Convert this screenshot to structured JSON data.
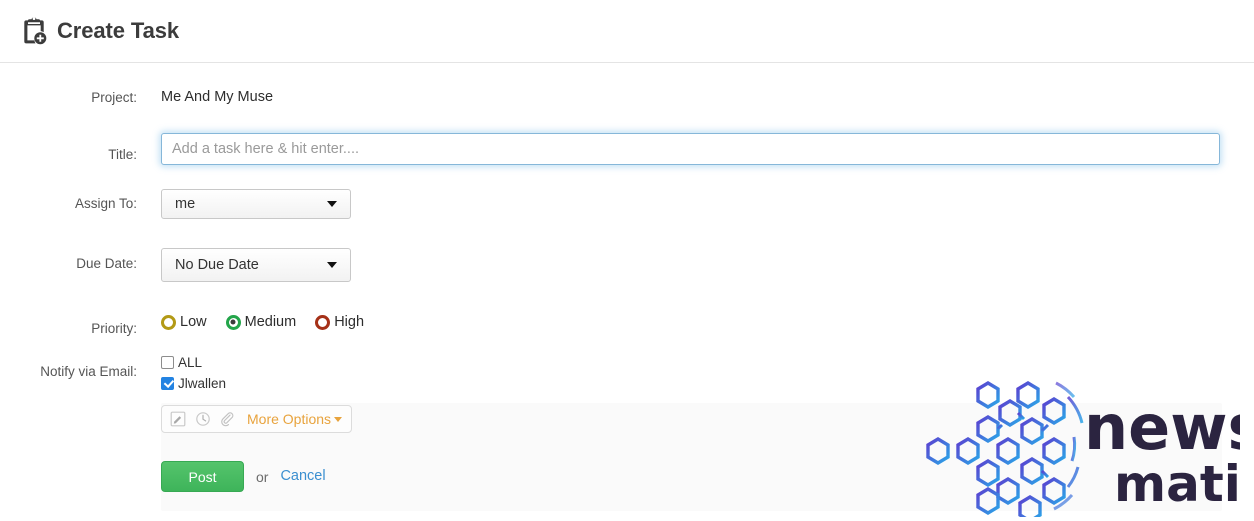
{
  "header": {
    "title": "Create Task",
    "icon": "clipboard-plus-icon"
  },
  "form": {
    "project": {
      "label": "Project:",
      "value": "Me And My Muse"
    },
    "title": {
      "label": "Title:",
      "value": "",
      "placeholder": "Add a task here & hit enter...."
    },
    "assign_to": {
      "label": "Assign To:",
      "value": "me"
    },
    "due_date": {
      "label": "Due Date:",
      "value": "No Due Date"
    },
    "priority": {
      "label": "Priority:",
      "options": [
        {
          "label": "Low",
          "color": "#b39a16",
          "selected": false
        },
        {
          "label": "Medium",
          "color": "#23a54a",
          "selected": true
        },
        {
          "label": "High",
          "color": "#a53118",
          "selected": false
        }
      ]
    },
    "notify": {
      "label": "Notify via Email:",
      "options": [
        {
          "label": "ALL",
          "checked": false
        },
        {
          "label": "Jlwallen",
          "checked": true
        }
      ]
    },
    "more_options": {
      "label": "More Options",
      "icons": [
        "note-edit-icon",
        "clock-icon",
        "paperclip-icon"
      ]
    },
    "actions": {
      "post_label": "Post",
      "or_label": "or",
      "cancel_label": "Cancel"
    }
  },
  "watermark": {
    "brand_primary": "newsmatic",
    "brand_line1": "news",
    "brand_line2": "matic"
  },
  "colors": {
    "accent_green": "#3eb45a",
    "accent_orange": "#e8a33d",
    "link_blue": "#3b8fd0",
    "focus_blue": "#86b7d9",
    "checkbox_blue": "#2383e2"
  }
}
